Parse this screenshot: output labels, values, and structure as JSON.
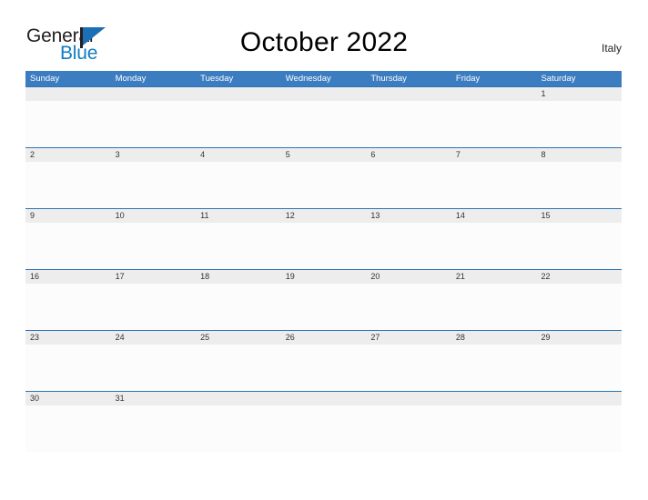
{
  "brand": {
    "name_part1": "General",
    "name_part2": "Blue",
    "flag_icon": "flag-icon",
    "primary_color": "#0f7dc2",
    "text_color": "#231f20"
  },
  "header": {
    "title": "October 2022",
    "country": "Italy"
  },
  "colors": {
    "header_blue": "#3b7dc0",
    "row_divider_blue": "#2e74b5",
    "number_band_gray": "#ededed",
    "cell_white": "#fcfcfc",
    "number_text": "#333333"
  },
  "calendar": {
    "month": "October",
    "year": "2022",
    "weekday_headers": [
      "Sunday",
      "Monday",
      "Tuesday",
      "Wednesday",
      "Thursday",
      "Friday",
      "Saturday"
    ],
    "weeks": [
      [
        "",
        "",
        "",
        "",
        "",
        "",
        "1"
      ],
      [
        "2",
        "3",
        "4",
        "5",
        "6",
        "7",
        "8"
      ],
      [
        "9",
        "10",
        "11",
        "12",
        "13",
        "14",
        "15"
      ],
      [
        "16",
        "17",
        "18",
        "19",
        "20",
        "21",
        "22"
      ],
      [
        "23",
        "24",
        "25",
        "26",
        "27",
        "28",
        "29"
      ],
      [
        "30",
        "31",
        "",
        "",
        "",
        "",
        ""
      ]
    ]
  }
}
